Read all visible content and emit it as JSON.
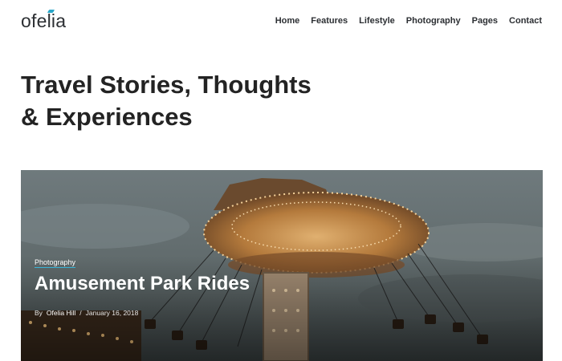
{
  "brand": {
    "logo_text": "ofelia",
    "accent_color": "#2aa7c9"
  },
  "nav": [
    "Home",
    "Features",
    "Lifestyle",
    "Photography",
    "Pages",
    "Contact"
  ],
  "hero": {
    "line1": "Travel Stories, Thoughts",
    "line2": "& Experiences"
  },
  "featured_post": {
    "category": "Photography",
    "title": "Amusement Park Rides",
    "by": "By",
    "author": "Ofelia Hill",
    "separator": "/",
    "date": "January 16, 2018"
  }
}
